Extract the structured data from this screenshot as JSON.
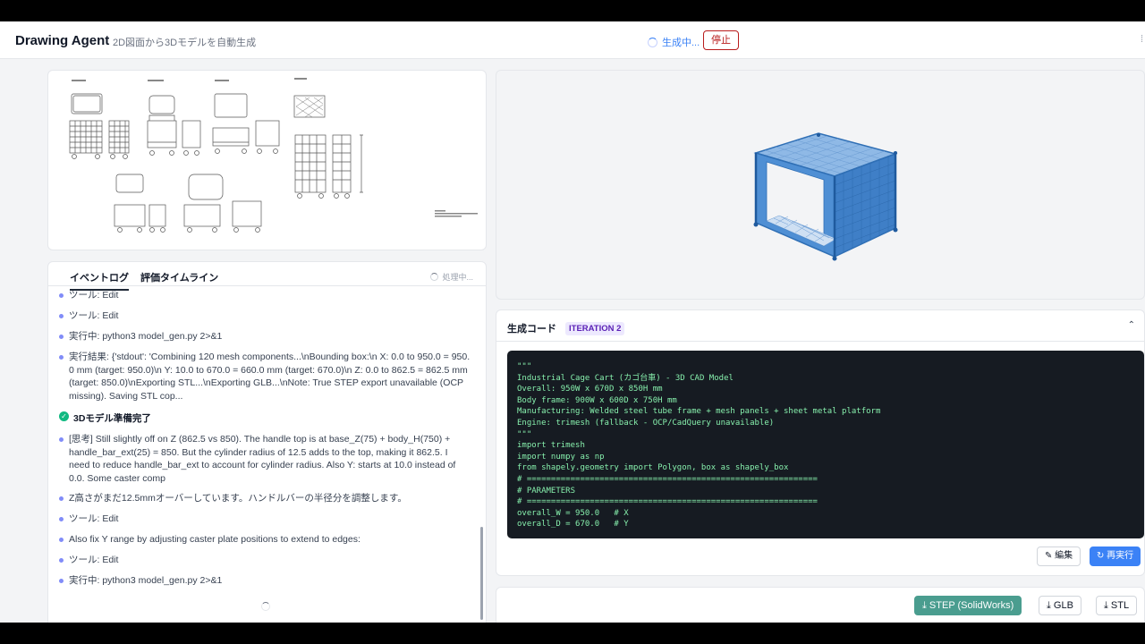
{
  "header": {
    "title": "Drawing Agent",
    "subtitle": "2D図面から3Dモデルを自動生成",
    "status": "生成中...",
    "stop_label": "停止"
  },
  "log_panel": {
    "tabs": [
      "イベントログ",
      "評価タイムライン"
    ],
    "processing": "処理中...",
    "items": [
      "ツール: Edit",
      "ツール: Edit",
      "実行中: python3 model_gen.py 2>&1",
      "実行結果: {'stdout': 'Combining 120 mesh components...\\nBounding box:\\n X: 0.0 to 950.0 = 950.0 mm (target: 950.0)\\n Y: 10.0 to 670.0 = 660.0 mm (target: 670.0)\\n Z: 0.0 to 862.5 = 862.5 mm (target: 850.0)\\nExporting STL...\\nExporting GLB...\\nNote: True STEP export unavailable (OCP missing). Saving STL cop...",
      "3Dモデル準備完了",
      "[思考] Still slightly off on Z (862.5 vs 850). The handle top is at base_Z(75) + body_H(750) + handle_bar_ext(25) = 850. But the cylinder radius of 12.5 adds to the top, making it 862.5. I need to reduce handle_bar_ext to account for cylinder radius. Also Y: starts at 10.0 instead of 0.0. Some caster comp",
      "Z高さがまだ12.5mmオーバーしています。ハンドルバーの半径分を調整します。",
      "ツール: Edit",
      "Also fix Y range by adjusting caster plate positions to extend to edges:",
      "ツール: Edit",
      "実行中: python3 model_gen.py 2>&1"
    ]
  },
  "code_panel": {
    "title": "生成コード",
    "badge": "ITERATION 2",
    "lines": [
      "\"\"\"",
      "Industrial Cage Cart (カゴ台車) - 3D CAD Model",
      "Overall: 950W x 670D x 850H mm",
      "Body frame: 900W x 600D x 750H mm",
      "Manufacturing: Welded steel tube frame + mesh panels + sheet metal platform",
      "Engine: trimesh (fallback - OCP/CadQuery unavailable)",
      "\"\"\"",
      "import trimesh",
      "import numpy as np",
      "from shapely.geometry import Polygon, box as shapely_box",
      "",
      "# ============================================================",
      "# PARAMETERS",
      "# ============================================================",
      "overall_W = 950.0   # X",
      "overall_D = 670.0   # Y"
    ],
    "edit_label": "編集",
    "rerun_label": "再実行"
  },
  "downloads": {
    "step_label": "STEP (SolidWorks)",
    "glb_label": "GLB",
    "stl_label": "STL"
  },
  "colors": {
    "accent": "#3b82f6",
    "stop": "#b91c1c",
    "step": "#4a9d8f",
    "model": "#4f8fd4"
  }
}
